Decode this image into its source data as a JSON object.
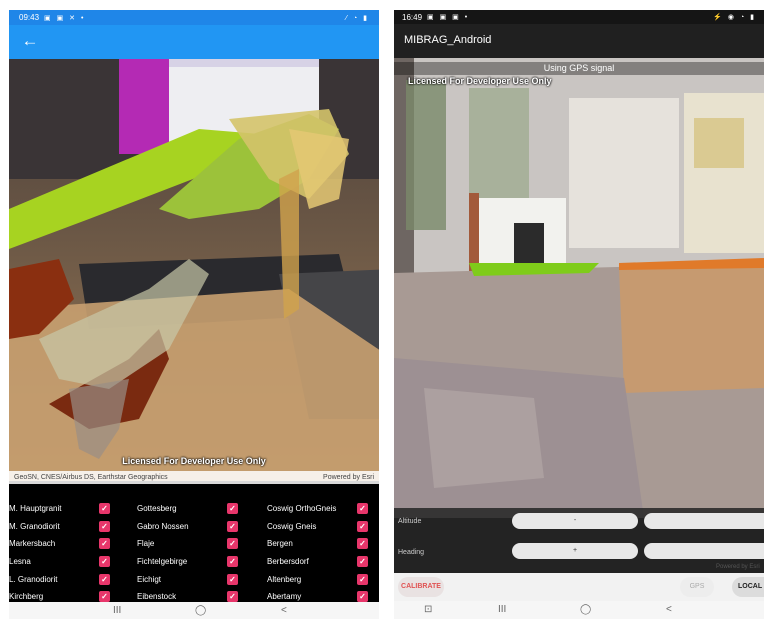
{
  "left_phone": {
    "status": {
      "time": "09:43",
      "glyphs": "▣ ▣ ✕ •",
      "right": "⁄ ◔ ▮"
    },
    "appbar": {
      "back_icon": "arrow-back-icon",
      "back_glyph": "←"
    },
    "edge_tab_glyph": "∕",
    "license": "Licensed For Developer Use Only",
    "attribution": "GeoSN, CNES/Airbus DS, Earthstar Geographics",
    "powered_by": "Powered by Esri",
    "layer_columns": [
      {
        "items": [
          {
            "name": "M. Hauptgranit",
            "checked": true
          },
          {
            "name": "M. Granodiorit",
            "checked": true
          },
          {
            "name": "Markersbach",
            "checked": true
          },
          {
            "name": "Lesna",
            "checked": true
          },
          {
            "name": "L. Granodiorit",
            "checked": true
          },
          {
            "name": "Kirchberg",
            "checked": true
          }
        ]
      },
      {
        "items": [
          {
            "name": "Gottesberg",
            "checked": true
          },
          {
            "name": "Gabro Nossen",
            "checked": true
          },
          {
            "name": "Flaje",
            "checked": true
          },
          {
            "name": "Fichtelgebirge",
            "checked": true
          },
          {
            "name": "Eichigt",
            "checked": true
          },
          {
            "name": "Eibenstock",
            "checked": true
          }
        ]
      },
      {
        "items": [
          {
            "name": "Coswig OrthoGneis",
            "checked": true
          },
          {
            "name": "Coswig Gneis",
            "checked": true
          },
          {
            "name": "Bergen",
            "checked": true
          },
          {
            "name": "Berbersdorf",
            "checked": true
          },
          {
            "name": "Altenberg",
            "checked": true
          },
          {
            "name": "Abertamy",
            "checked": true
          }
        ]
      }
    ],
    "check_glyph": "✓",
    "nav": {
      "recents": "III",
      "home": "◯",
      "back": "<"
    }
  },
  "right_tablet": {
    "status": {
      "time": "16:49",
      "glyphs": "▣ ▣ ▣ •",
      "right": "⚡ ◉ ◔ ▮"
    },
    "app_title": "MIBRAG_Android",
    "gps_banner": "Using GPS signal",
    "license": "Licensed For Developer Use Only",
    "panel": {
      "altitude_label": "Altitude",
      "heading_label": "Heading",
      "slider_minus": "-",
      "slider_plus": "+"
    },
    "powered_by": "Powered by Esri",
    "buttons": {
      "calibrate": "CALIBRATE",
      "gps": "GPS",
      "local": "LOCAL"
    },
    "nav": {
      "screenshot": "⊡",
      "recents": "III",
      "home": "◯",
      "back": "<"
    }
  }
}
